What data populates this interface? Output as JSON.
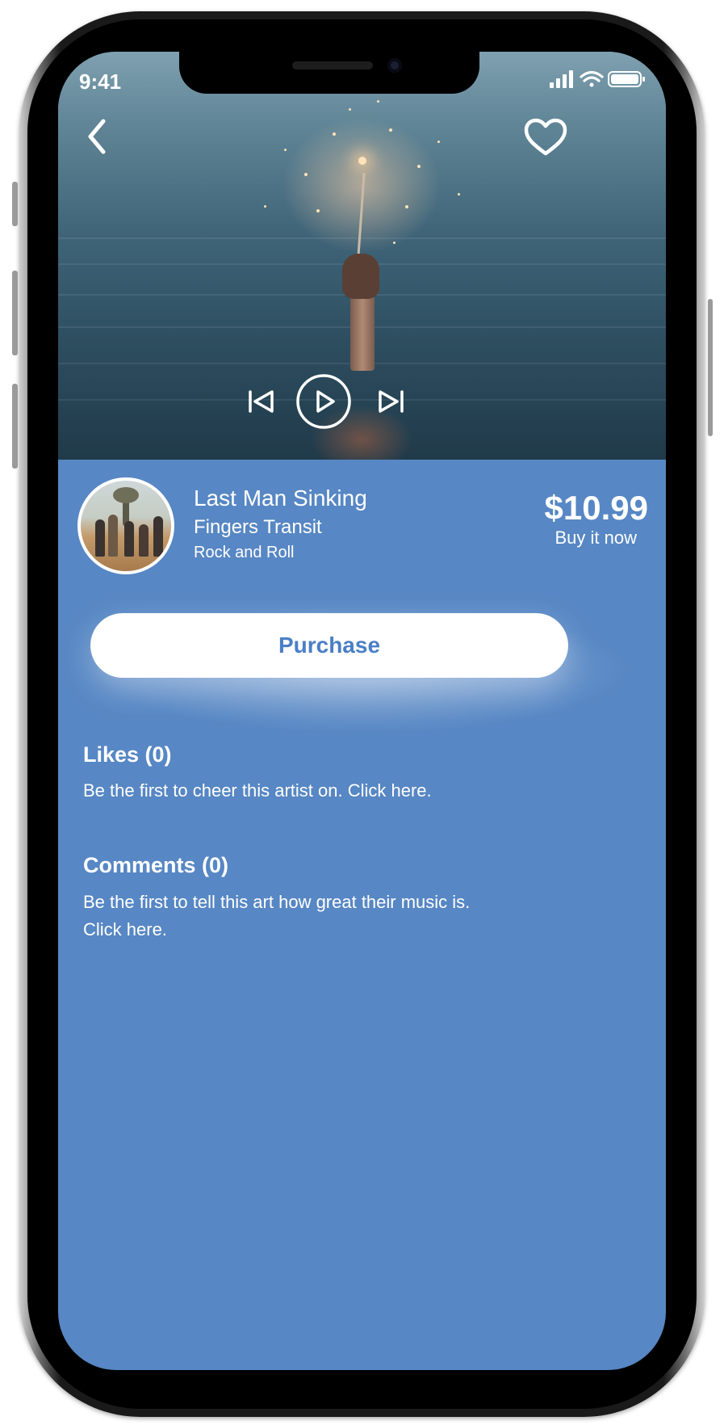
{
  "status_bar": {
    "time": "9:41"
  },
  "header": {
    "back_icon": "chevron-left-icon",
    "favorite_icon": "heart-outline-icon"
  },
  "player": {
    "prev_icon": "skip-previous-icon",
    "play_icon": "play-icon",
    "next_icon": "skip-next-icon"
  },
  "track": {
    "title": "Last Man Sinking",
    "artist": "Fingers Transit",
    "genre": "Rock and Roll",
    "price": "$10.99",
    "buy_label": "Buy it now"
  },
  "actions": {
    "purchase_label": "Purchase"
  },
  "likes": {
    "heading": "Likes (0)",
    "body": "Be the first to cheer this artist on. Click here."
  },
  "comments": {
    "heading": "Comments (0)",
    "body_line1": "Be the first to tell this art how great their music is.",
    "body_line2": "Click here."
  },
  "colors": {
    "accent": "#4a7fc6",
    "background": "#5787c4",
    "text": "#ffffff"
  }
}
